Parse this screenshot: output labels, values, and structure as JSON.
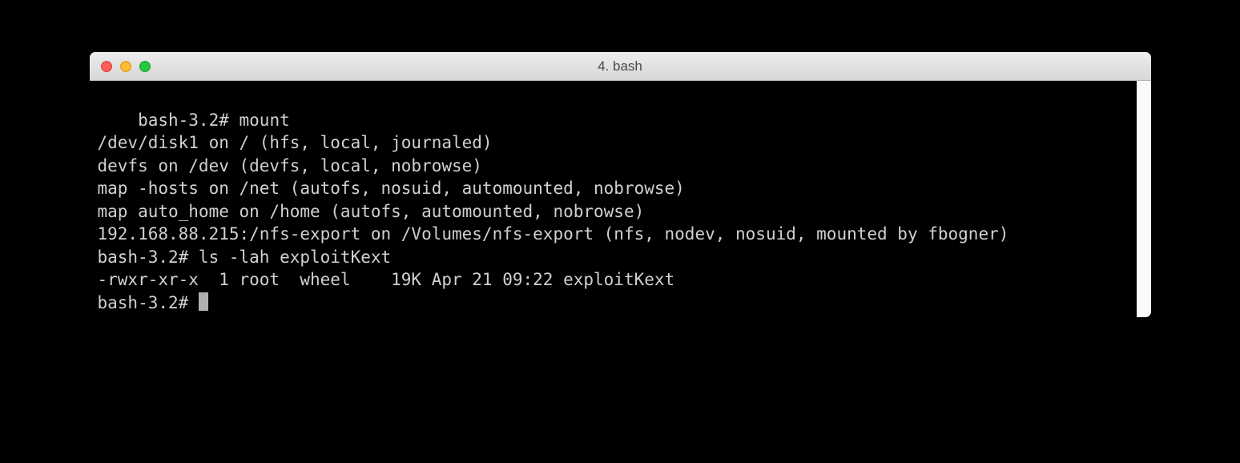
{
  "window": {
    "title": "4. bash"
  },
  "terminal": {
    "lines": [
      "bash-3.2# mount",
      "/dev/disk1 on / (hfs, local, journaled)",
      "devfs on /dev (devfs, local, nobrowse)",
      "map -hosts on /net (autofs, nosuid, automounted, nobrowse)",
      "map auto_home on /home (autofs, automounted, nobrowse)",
      "192.168.88.215:/nfs-export on /Volumes/nfs-export (nfs, nodev, nosuid, mounted by fbogner)",
      "bash-3.2# ls -lah exploitKext",
      "-rwxr-xr-x  1 root  wheel    19K Apr 21 09:22 exploitKext"
    ],
    "prompt": "bash-3.2# "
  }
}
